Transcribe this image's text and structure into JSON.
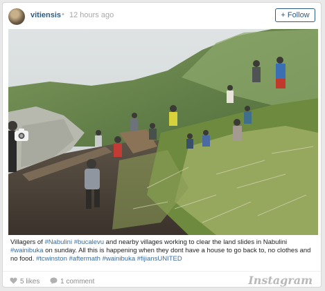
{
  "post": {
    "username": "vitiensis",
    "separator": "•",
    "timestamp": "12 hours ago",
    "follow_label": "Follow"
  },
  "caption": {
    "parts": {
      "p1": "Villagers of ",
      "t1": "#Nabulini",
      "s1": " ",
      "t2": "#bucalevu",
      "p2": " and nearby villages working to clear the land slides in Nabulini ",
      "t3": "#wainibuka",
      "p3": " on sunday. All this is happening when they dont have a house to go back to, no clothes and no food. ",
      "t4": "#tcwinston",
      "s2": " ",
      "t5": "#aftermath",
      "s3": " ",
      "t6": "#wainibuka",
      "s4": " ",
      "t7": "#fijiansUNITED"
    }
  },
  "footer": {
    "likes_label": "5 likes",
    "comments_label": "1 comment",
    "brand": "Instagram"
  },
  "colors": {
    "accent": "#2b5a83",
    "hashtag": "#3d6b98",
    "muted": "#8d8d8d"
  },
  "icons": {
    "like": "heart-icon",
    "comment": "speech-bubble-icon",
    "camera": "camera-icon"
  }
}
